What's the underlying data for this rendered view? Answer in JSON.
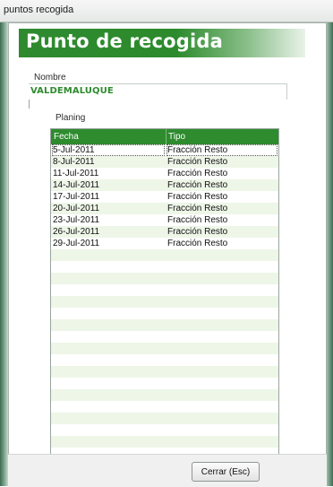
{
  "window": {
    "title": "puntos recogida"
  },
  "header": {
    "title": "Punto de recogida"
  },
  "nombre": {
    "label": "Nombre",
    "value": "VALDEMALUQUE"
  },
  "planing": {
    "label": "Planing",
    "columns": [
      "Fecha",
      "Tipo"
    ],
    "rows": [
      {
        "fecha": "5-Jul-2011",
        "tipo": "Fracción Resto"
      },
      {
        "fecha": "8-Jul-2011",
        "tipo": "Fracción Resto"
      },
      {
        "fecha": "11-Jul-2011",
        "tipo": "Fracción Resto"
      },
      {
        "fecha": "14-Jul-2011",
        "tipo": "Fracción Resto"
      },
      {
        "fecha": "17-Jul-2011",
        "tipo": "Fracción Resto"
      },
      {
        "fecha": "20-Jul-2011",
        "tipo": "Fracción Resto"
      },
      {
        "fecha": "23-Jul-2011",
        "tipo": "Fracción Resto"
      },
      {
        "fecha": "26-Jul-2011",
        "tipo": "Fracción Resto"
      },
      {
        "fecha": "29-Jul-2011",
        "tipo": "Fracción Resto"
      }
    ]
  },
  "footer": {
    "close_label": "Cerrar (Esc)"
  },
  "colors": {
    "accent": "#2e8b2e",
    "row_alt": "#eef6e8"
  }
}
